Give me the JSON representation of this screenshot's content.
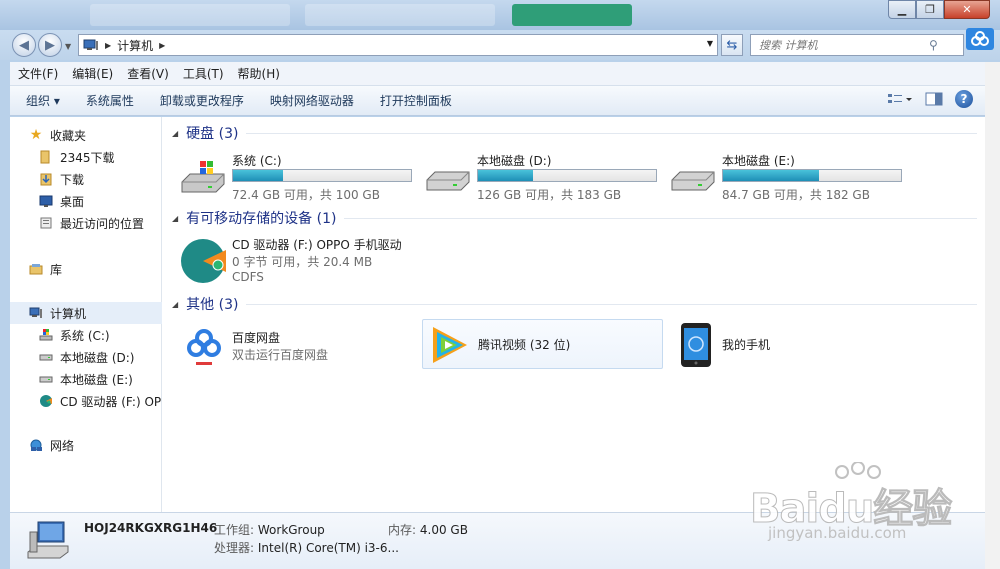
{
  "window": {
    "minimize": "▁",
    "maximize": "❐",
    "close": "✕"
  },
  "address": {
    "crumb": "计算机",
    "search_placeholder": "搜索 计算机"
  },
  "menu": [
    "文件(F)",
    "编辑(E)",
    "查看(V)",
    "工具(T)",
    "帮助(H)"
  ],
  "toolbar": {
    "organize": "组织 ▾",
    "items": [
      "系统属性",
      "卸载或更改程序",
      "映射网络驱动器",
      "打开控制面板"
    ],
    "help": "?"
  },
  "nav": {
    "favorites": "收藏夹",
    "fav_items": [
      "2345下载",
      "下载",
      "桌面",
      "最近访问的位置"
    ],
    "library": "库",
    "computer": "计算机",
    "computer_items": [
      "系统 (C:)",
      "本地磁盘 (D:)",
      "本地磁盘 (E:)",
      "CD 驱动器 (F:) OPPO"
    ],
    "network": "网络"
  },
  "groups": {
    "hdd": "硬盘 (3)",
    "removable": "有可移动存储的设备 (1)",
    "other": "其他 (3)"
  },
  "drives": [
    {
      "name": "系统 (C:)",
      "info": "72.4 GB 可用，共 100 GB",
      "used_fraction": 0.28
    },
    {
      "name": "本地磁盘 (D:)",
      "info": "126 GB 可用，共 183 GB",
      "used_fraction": 0.31
    },
    {
      "name": "本地磁盘 (E:)",
      "info": "84.7 GB 可用，共 182 GB",
      "used_fraction": 0.54
    }
  ],
  "cd": {
    "name": "CD 驱动器 (F:) OPPO 手机驱动",
    "info": "0 字节 可用，共 20.4 MB",
    "fs": "CDFS"
  },
  "others": {
    "baidu": {
      "name": "百度网盘",
      "sub": "双击运行百度网盘"
    },
    "tencent": {
      "name": "腾讯视频 (32 位)"
    },
    "phone": {
      "name": "我的手机"
    }
  },
  "details": {
    "pcname": "HOJ24RKGXRG1H46",
    "workgroup_label": "工作组:",
    "workgroup": "WorkGroup",
    "memory_label": "内存:",
    "memory": "4.00 GB",
    "cpu_label": "处理器:",
    "cpu": "Intel(R) Core(TM) i3-6..."
  },
  "watermark": {
    "brand": "Baidu经验",
    "url": "jingyan.baidu.com"
  },
  "colors": {
    "accent": "#1e3287",
    "bar_fill": "#2ba3c8"
  }
}
